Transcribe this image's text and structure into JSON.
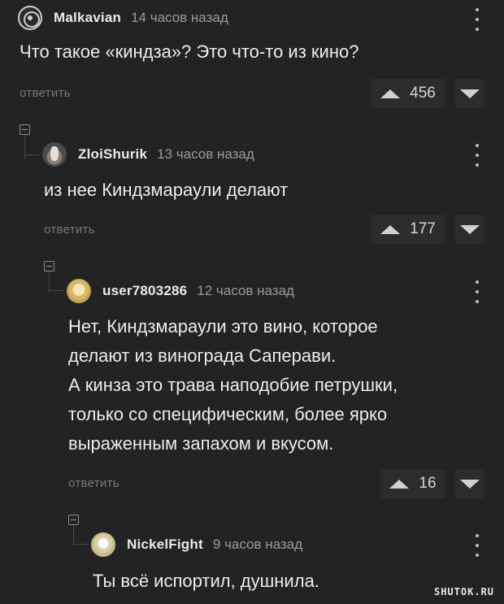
{
  "comments": [
    {
      "author": "Malkavian",
      "time": "14 часов назад",
      "text": "Что такое «киндза»? Это что-то из кино?",
      "reply_label": "ответить",
      "rating": "456",
      "avatar_icon": "malkavian-symbol-avatar"
    },
    {
      "author": "ZloiShurik",
      "time": "13 часов назад",
      "text": "из нее Киндзмараули делают",
      "reply_label": "ответить",
      "rating": "177",
      "avatar_icon": "goat-photo-avatar"
    },
    {
      "author": "user7803286",
      "time": "12 часов назад",
      "text_lines": [
        "Нет, Киндзмараули  это вино, которое",
        "делают из винограда Саперави.",
        "А кинза это трава наподобие петрушки,",
        "только со специфическим, более ярко",
        "выраженным запахом и вкусом."
      ],
      "reply_label": "ответить",
      "rating": "16",
      "avatar_icon": "default-avatar"
    },
    {
      "author": "NickelFight",
      "time": "9 часов назад",
      "text": "Ты всё испортил, душнила.",
      "avatar_icon": "default-avatar"
    }
  ],
  "watermark": "SHUTOK.RU",
  "colors": {
    "background": "#232325",
    "text": "#ececec",
    "muted": "#9a9a9a",
    "button_bg": "#2c2c2e"
  }
}
